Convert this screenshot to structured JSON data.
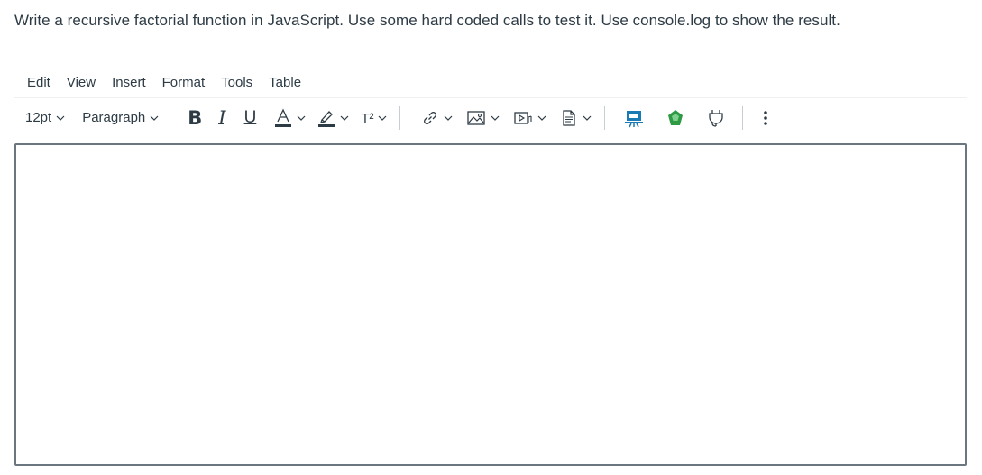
{
  "prompt": {
    "text": "Write a recursive factorial function in JavaScript.  Use some hard coded calls to test it.  Use console.log to show the result."
  },
  "menubar": {
    "items": [
      {
        "label": "Edit"
      },
      {
        "label": "View"
      },
      {
        "label": "Insert"
      },
      {
        "label": "Format"
      },
      {
        "label": "Tools"
      },
      {
        "label": "Table"
      }
    ]
  },
  "toolbar": {
    "font_size": "12pt",
    "block_format": "Paragraph",
    "bold_glyph": "B",
    "italic_glyph": "I",
    "underline_glyph": "U",
    "text_color_glyph": "A",
    "superscript_glyph": "T²",
    "icons": {
      "text_color": "text-color-icon",
      "highlight": "highlight-icon",
      "superscript": "superscript-icon",
      "link": "link-icon",
      "image": "image-icon",
      "media": "media-icon",
      "document": "document-icon",
      "apps": "presentation-app-icon",
      "recycle": "green-circular-app-icon",
      "plugin": "plug-icon",
      "more": "more-vertical-icon"
    },
    "colors": {
      "text_color_underline": "#2d3b45",
      "app_blue": "#1a7ab4",
      "app_green": "#2e9a44"
    }
  },
  "editor": {
    "value": ""
  }
}
